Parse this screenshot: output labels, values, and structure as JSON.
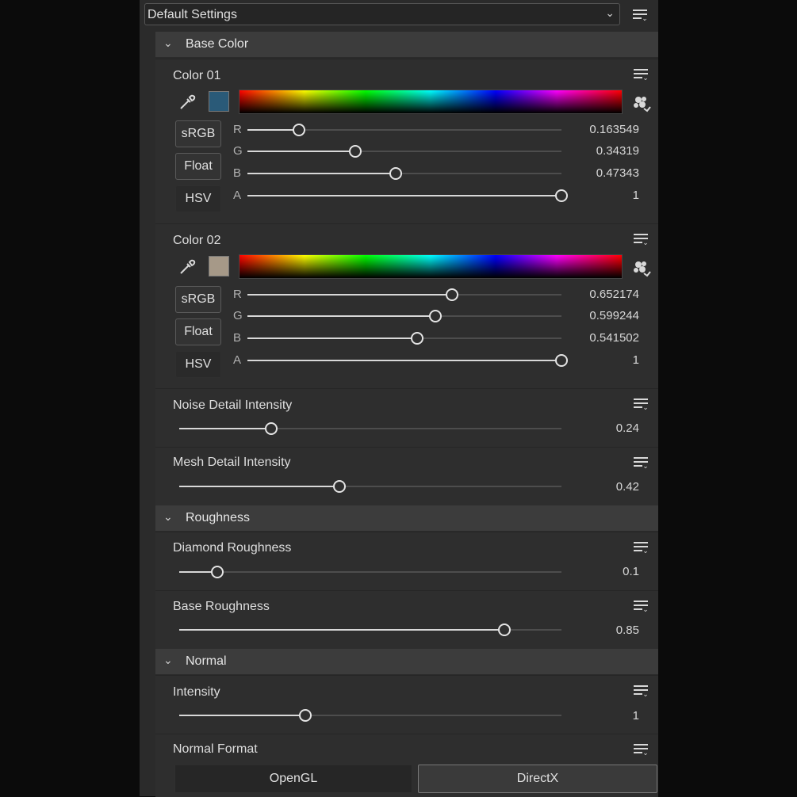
{
  "preset": {
    "label": "Default Settings"
  },
  "sections": {
    "base_color": "Base Color",
    "roughness": "Roughness",
    "normal": "Normal"
  },
  "color01": {
    "label": "Color 01",
    "swatch": "#2a5a78",
    "modes": [
      "sRGB",
      "Float",
      "HSV"
    ],
    "channels": [
      {
        "name": "R",
        "value": "0.163549",
        "fraction": 0.163549
      },
      {
        "name": "G",
        "value": "0.34319",
        "fraction": 0.34319
      },
      {
        "name": "B",
        "value": "0.47343",
        "fraction": 0.47343
      },
      {
        "name": "A",
        "value": "1",
        "fraction": 1
      }
    ]
  },
  "color02": {
    "label": "Color 02",
    "swatch": "#a69988",
    "modes": [
      "sRGB",
      "Float",
      "HSV"
    ],
    "channels": [
      {
        "name": "R",
        "value": "0.652174",
        "fraction": 0.652174
      },
      {
        "name": "G",
        "value": "0.599244",
        "fraction": 0.599244
      },
      {
        "name": "B",
        "value": "0.541502",
        "fraction": 0.541502
      },
      {
        "name": "A",
        "value": "1",
        "fraction": 1
      }
    ]
  },
  "noise_detail": {
    "label": "Noise Detail Intensity",
    "value": "0.24",
    "fraction": 0.24
  },
  "mesh_detail": {
    "label": "Mesh Detail Intensity",
    "value": "0.42",
    "fraction": 0.42
  },
  "diamond_roughness": {
    "label": "Diamond Roughness",
    "value": "0.1",
    "fraction": 0.1
  },
  "base_roughness": {
    "label": "Base Roughness",
    "value": "0.85",
    "fraction": 0.85
  },
  "normal_intensity": {
    "label": "Intensity",
    "value": "1",
    "fraction": 0.33
  },
  "normal_format": {
    "label": "Normal Format",
    "options": [
      "OpenGL",
      "DirectX"
    ],
    "selected": "DirectX"
  },
  "icons": {
    "menu": "property-menu-icon",
    "eyedropper": "eyedropper-icon",
    "palette": "palette-icon",
    "chevron": "chevron-down-icon"
  }
}
